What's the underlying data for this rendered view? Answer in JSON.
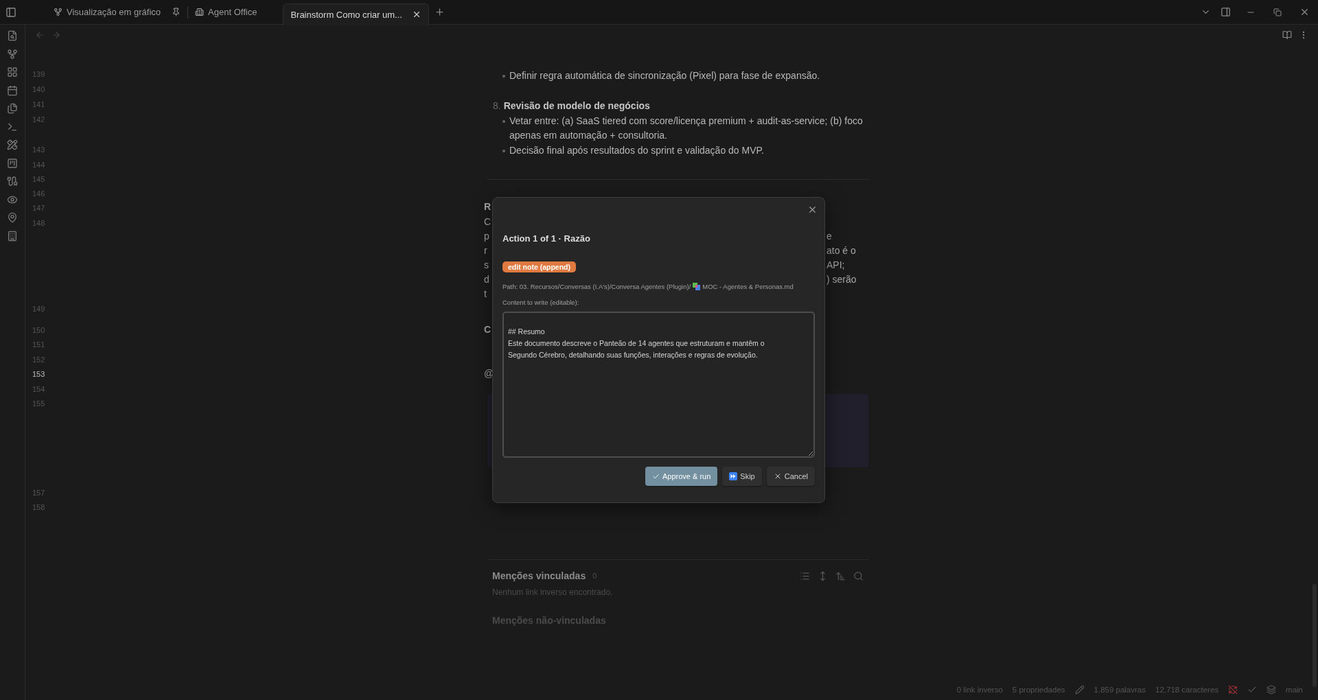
{
  "title_bar": {
    "tabs": [
      {
        "label": "Visualização em gráfico",
        "pinned": true,
        "selected": false
      },
      {
        "label": "Agent Office",
        "pinned": false,
        "selected": false
      },
      {
        "label": "Brainstorm Como criar um...",
        "pinned": false,
        "selected": true
      }
    ]
  },
  "gutter": {
    "line_numbers": [
      {
        "label": "139",
        "selected": false
      },
      {
        "label": "140",
        "selected": false
      },
      {
        "label": "141",
        "selected": false
      },
      {
        "label": "142",
        "selected": false
      },
      {
        "label": "143",
        "selected": false
      },
      {
        "label": "144",
        "selected": false
      },
      {
        "label": "145",
        "selected": false
      },
      {
        "label": "146",
        "selected": false
      },
      {
        "label": "147",
        "selected": false
      },
      {
        "label": "148",
        "selected": false
      },
      {
        "label": "149",
        "selected": false
      },
      {
        "label": "150",
        "selected": false
      },
      {
        "label": "151",
        "selected": false
      },
      {
        "label": "152",
        "selected": false
      },
      {
        "label": "153",
        "selected": true
      },
      {
        "label": "154",
        "selected": false
      },
      {
        "label": "155",
        "selected": false
      },
      {
        "label": "157",
        "selected": false
      },
      {
        "label": "158",
        "selected": false
      }
    ]
  },
  "document": {
    "blocks": [
      {
        "kind": "bullet",
        "text": "Definir regra automática de sincronização (Pixel) para fase de expansão."
      },
      {
        "kind": "numbered",
        "number": "8.",
        "text": "Revisão de modelo de negócios"
      },
      {
        "kind": "bullet",
        "text": "Vetar entre: (a) SaaS tiered com score/licença premium + audit-as-service; (b) foco apenas em automação + consultoria."
      },
      {
        "kind": "bullet",
        "text": "Decisão final após resultados do sprint e validação do MVP."
      },
      {
        "kind": "rule"
      },
      {
        "kind": "fragment",
        "bold": true,
        "left": "R"
      },
      {
        "kind": "fragment",
        "bold": false,
        "left": "C"
      },
      {
        "kind": "fragment",
        "bold": false,
        "left": "p",
        "right": "e"
      },
      {
        "kind": "fragment",
        "bold": false,
        "left": "r",
        "right": "ato é o"
      },
      {
        "kind": "fragment",
        "bold": false,
        "left": "s",
        "right": "API;"
      },
      {
        "kind": "fragment",
        "bold": false,
        "left": "d",
        "right": ") serão"
      },
      {
        "kind": "fragment",
        "bold": false,
        "left": "t"
      },
      {
        "kind": "fragment",
        "bold": true,
        "left": "C"
      },
      {
        "kind": "fragment",
        "bold": false,
        "left": "@"
      },
      {
        "kind": "callout"
      }
    ]
  },
  "backlinks": {
    "linked_title": "Menções vinculadas",
    "linked_count": "0",
    "empty_text": "Nenhum link inverso encontrado.",
    "unlinked_title": "Menções não-vinculadas"
  },
  "status_bar": {
    "backlinks": "0 link inverso",
    "properties": "5 propriedades",
    "words": "1.859 palavras",
    "characters": "12.718 caracteres",
    "branch": "main"
  },
  "modal": {
    "title": "Action 1 of 1 · Razão",
    "badge": "edit note (append)",
    "path_prefix": "Path: 03. Recursos/Conversas (I.A's)/Conversa Agentes (Plugin)/",
    "path_file": "MOC - Agentes & Personas.md",
    "content_label": "Content to write (editable):",
    "content": "\n## Resumo\nEste documento descreve o Panteão de 14 agentes que estruturam e mantêm o Segundo Cérebro, detalhando suas funções, interações e regras de evolução.",
    "buttons": [
      {
        "kind": "approve",
        "label": "Approve & run"
      },
      {
        "kind": "skip",
        "label": "Skip"
      },
      {
        "kind": "cancel",
        "label": "Cancel"
      }
    ]
  }
}
